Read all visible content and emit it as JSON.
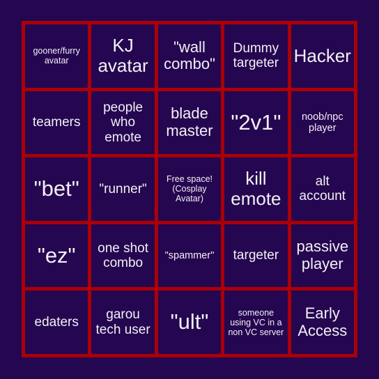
{
  "card": {
    "colors": {
      "background": "#250650",
      "grid_line": "#aa0007",
      "cell_background": "#250650",
      "text": "#f2f0f5"
    },
    "columns": 5,
    "rows": 5,
    "cells": [
      {
        "text": "gooner/furry avatar",
        "size": "fs-xs"
      },
      {
        "text": "KJ avatar",
        "size": "fs-xl"
      },
      {
        "text": "\"wall combo\"",
        "size": "fs-lg"
      },
      {
        "text": "Dummy targeter",
        "size": "fs-md"
      },
      {
        "text": "Hacker",
        "size": "fs-xl"
      },
      {
        "text": "teamers",
        "size": "fs-md"
      },
      {
        "text": "people who emote",
        "size": "fs-md"
      },
      {
        "text": "blade master",
        "size": "fs-lg"
      },
      {
        "text": "\"2v1\"",
        "size": "fs-xxl"
      },
      {
        "text": "noob/npc player",
        "size": "fs-sm"
      },
      {
        "text": "\"bet\"",
        "size": "fs-xxl"
      },
      {
        "text": "\"runner\"",
        "size": "fs-md"
      },
      {
        "text": "Free space! (Cosplay Avatar)",
        "size": "fs-xs"
      },
      {
        "text": "kill emote",
        "size": "fs-xl"
      },
      {
        "text": "alt account",
        "size": "fs-md"
      },
      {
        "text": "\"ez\"",
        "size": "fs-xxl"
      },
      {
        "text": "one shot combo",
        "size": "fs-md"
      },
      {
        "text": "\"spammer\"",
        "size": "fs-sm"
      },
      {
        "text": "targeter",
        "size": "fs-md"
      },
      {
        "text": "passive player",
        "size": "fs-lg"
      },
      {
        "text": "edaters",
        "size": "fs-md"
      },
      {
        "text": "garou tech user",
        "size": "fs-md"
      },
      {
        "text": "\"ult\"",
        "size": "fs-xxl"
      },
      {
        "text": "someone using VC in a non VC server",
        "size": "fs-xs"
      },
      {
        "text": "Early Access",
        "size": "fs-lg"
      }
    ]
  }
}
